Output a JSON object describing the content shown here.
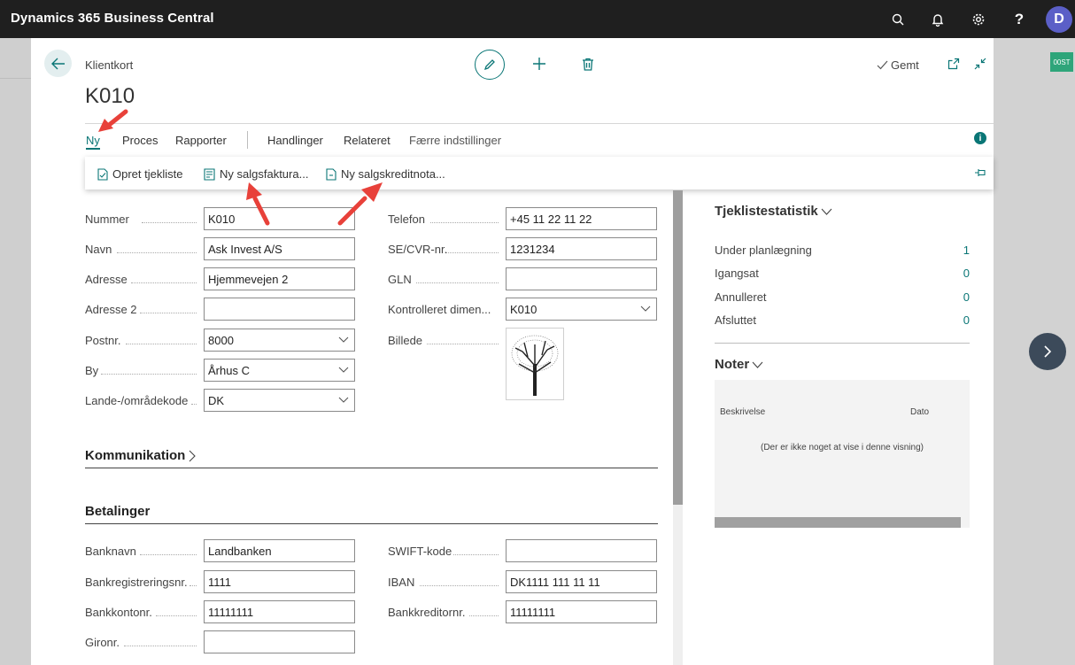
{
  "app": {
    "title": "Dynamics 365 Business Central",
    "user_initial": "D"
  },
  "side": {
    "tag": "00ST"
  },
  "page": {
    "breadcrumb": "Klientkort",
    "title": "K010",
    "saved_label": "Gemt"
  },
  "tabs": [
    {
      "label": "Ny"
    },
    {
      "label": "Proces"
    },
    {
      "label": "Rapporter"
    },
    {
      "label": "Handlinger"
    },
    {
      "label": "Relateret"
    },
    {
      "label": "Færre indstillinger"
    }
  ],
  "dropdown": {
    "items": [
      {
        "label": "Opret tjekliste"
      },
      {
        "label": "Ny salgsfaktura..."
      },
      {
        "label": "Ny salgskreditnota..."
      }
    ]
  },
  "general": {
    "left": [
      {
        "label": "Nummer",
        "value": "K010"
      },
      {
        "label": "Navn",
        "value": "Ask Invest A/S"
      },
      {
        "label": "Adresse",
        "value": "Hjemmevejen 2"
      },
      {
        "label": "Adresse 2",
        "value": ""
      },
      {
        "label": "Postnr.",
        "value": "8000"
      },
      {
        "label": "By",
        "value": "Århus C"
      },
      {
        "label": "Lande-/områdekode",
        "value": "DK"
      }
    ],
    "right": [
      {
        "label": "Telefon",
        "value": "+45 11 22 11 22"
      },
      {
        "label": "SE/CVR-nr.",
        "value": "1231234"
      },
      {
        "label": "GLN",
        "value": ""
      },
      {
        "label": "Kontrolleret dimen...",
        "value": "K010"
      },
      {
        "label": "Billede"
      }
    ]
  },
  "sections": {
    "communication": "Kommunikation",
    "payments": "Betalinger"
  },
  "payments": {
    "left": [
      {
        "label": "Banknavn",
        "value": "Landbanken"
      },
      {
        "label": "Bankregistreringsnr.",
        "value": "1111"
      },
      {
        "label": "Bankkontonr.",
        "value": "11111111"
      },
      {
        "label": "Gironr.",
        "value": ""
      }
    ],
    "right": [
      {
        "label": "SWIFT-kode",
        "value": ""
      },
      {
        "label": "IBAN",
        "value": "DK1111 111 11 11"
      },
      {
        "label": "Bankkreditornr.",
        "value": "11111111"
      }
    ]
  },
  "factbox": {
    "stats_title": "Tjeklistestatistik",
    "stats": [
      {
        "label": "Under planlægning",
        "value": "1"
      },
      {
        "label": "Igangsat",
        "value": "0"
      },
      {
        "label": "Annulleret",
        "value": "0"
      },
      {
        "label": "Afsluttet",
        "value": "0"
      }
    ],
    "notes_title": "Noter",
    "notes_col_description": "Beskrivelse",
    "notes_col_date": "Dato",
    "notes_empty": "(Der er ikke noget at vise i denne visning)"
  },
  "colors": {
    "accent": "#0a7676",
    "topbar": "#1f1f1f",
    "annotation_arrow": "#e8413a"
  }
}
